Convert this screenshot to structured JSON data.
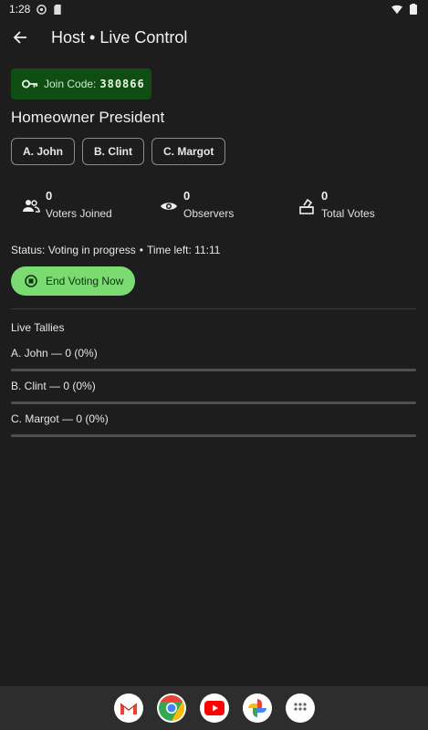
{
  "status_bar": {
    "time": "1:28"
  },
  "app_bar": {
    "title": "Host • Live Control"
  },
  "join": {
    "label": "Join Code:",
    "code": "380866"
  },
  "election": {
    "title": "Homeowner President"
  },
  "candidates": [
    {
      "label": "A. John"
    },
    {
      "label": "B. Clint"
    },
    {
      "label": "C. Margot"
    }
  ],
  "stats": {
    "voters_joined": {
      "value": "0",
      "label": "Voters Joined"
    },
    "observers": {
      "value": "0",
      "label": "Observers"
    },
    "total_votes": {
      "value": "0",
      "label": "Total Votes"
    }
  },
  "status": {
    "text": "Status: Voting in progress",
    "separator": "•",
    "time_left": "Time left: 11:11"
  },
  "end_button": {
    "label": "End Voting Now"
  },
  "tallies": {
    "title": "Live Tallies",
    "items": [
      {
        "label": "A. John — 0 (0%)",
        "fraction": 0
      },
      {
        "label": "B. Clint — 0 (0%)",
        "fraction": 0
      },
      {
        "label": "C. Margot — 0 (0%)",
        "fraction": 0
      }
    ]
  },
  "colors": {
    "accent": "#79db72",
    "join_chip_bg": "#0f4d12",
    "background": "#1c1d1c"
  },
  "dock": [
    "gmail-icon",
    "chrome-icon",
    "youtube-icon",
    "photos-icon",
    "app-drawer-icon"
  ]
}
